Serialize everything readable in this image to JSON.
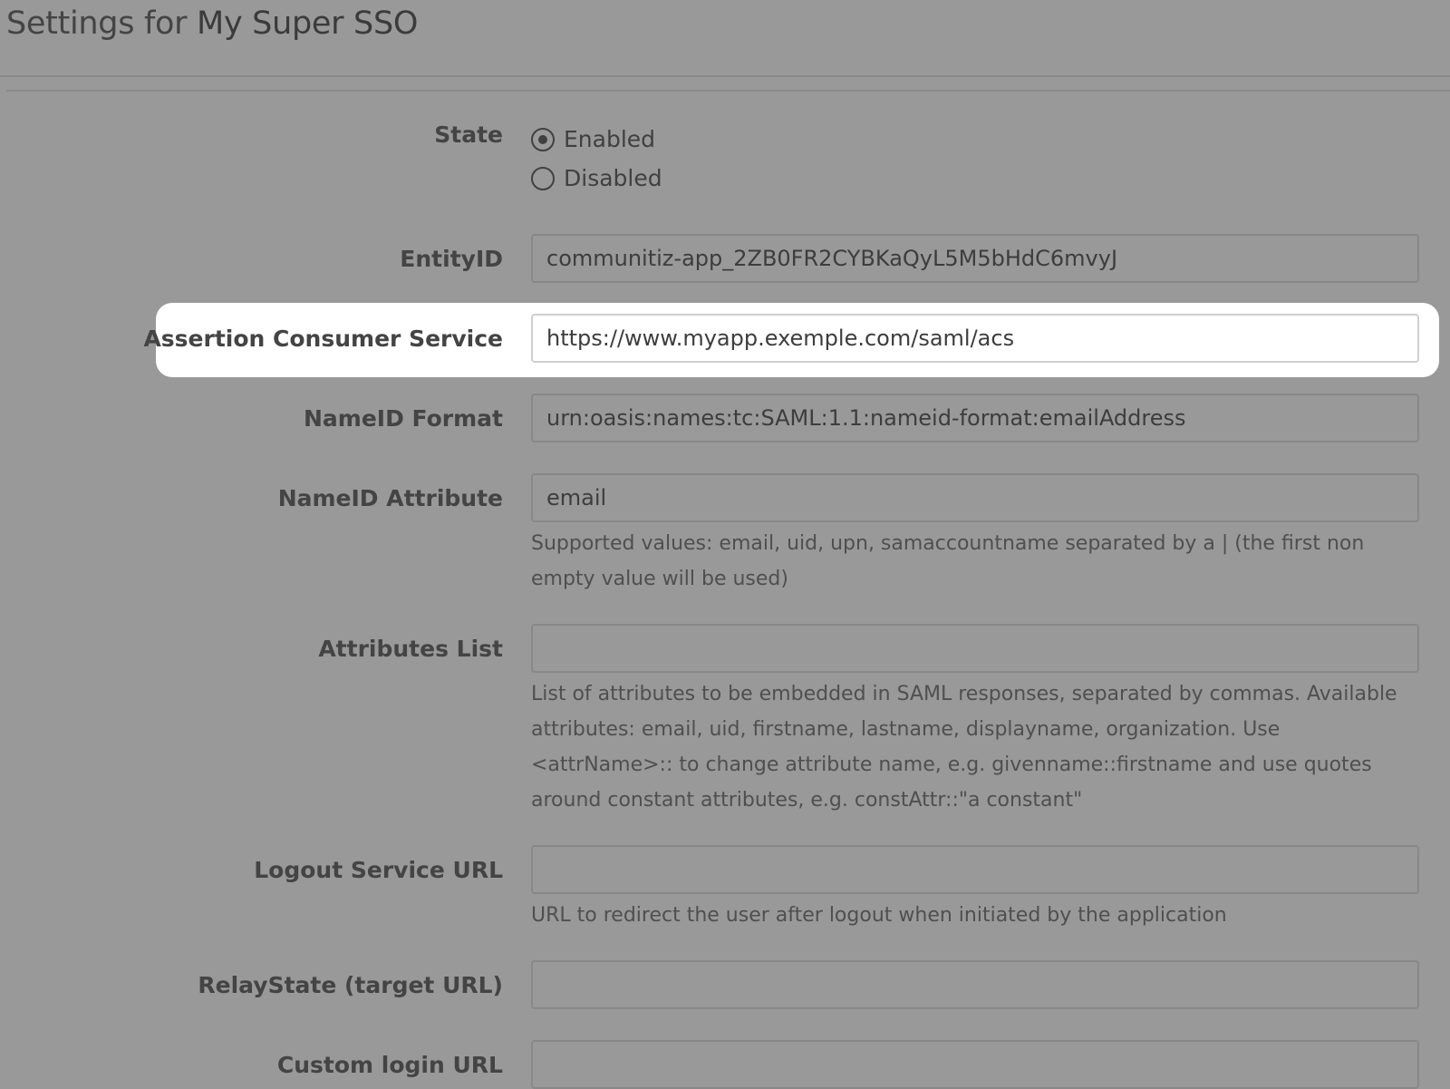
{
  "header": {
    "title_prefix": "Settings for",
    "app_name": "My Super SSO"
  },
  "form": {
    "state": {
      "label": "State",
      "options": [
        {
          "label": "Enabled",
          "checked": true
        },
        {
          "label": "Disabled",
          "checked": false
        }
      ]
    },
    "entity_id": {
      "label": "EntityID",
      "value": "communitiz-app_2ZB0FR2CYBKaQyL5M5bHdC6mvyJ"
    },
    "acs": {
      "label": "Assertion Consumer Service",
      "value": "https://www.myapp.exemple.com/saml/acs"
    },
    "nameid_format": {
      "label": "NameID Format",
      "value": "urn:oasis:names:tc:SAML:1.1:nameid-format:emailAddress"
    },
    "nameid_attribute": {
      "label": "NameID Attribute",
      "value": "email",
      "help": "Supported values: email, uid, upn, samaccountname separated by a | (the first non empty value will be used)"
    },
    "attributes_list": {
      "label": "Attributes List",
      "value": "",
      "help": "List of attributes to be embedded in SAML responses, separated by commas. Available attributes: email, uid, firstname, lastname, displayname, organization. Use <attrName>:: to change attribute name, e.g. givenname::firstname and use quotes around constant attributes, e.g. constAttr::\"a constant\""
    },
    "logout_url": {
      "label": "Logout Service URL",
      "value": "",
      "help": "URL to redirect the user after logout when initiated by the application"
    },
    "relay_state": {
      "label": "RelayState (target URL)",
      "value": ""
    },
    "custom_login_url": {
      "label": "Custom login URL",
      "value": ""
    }
  }
}
